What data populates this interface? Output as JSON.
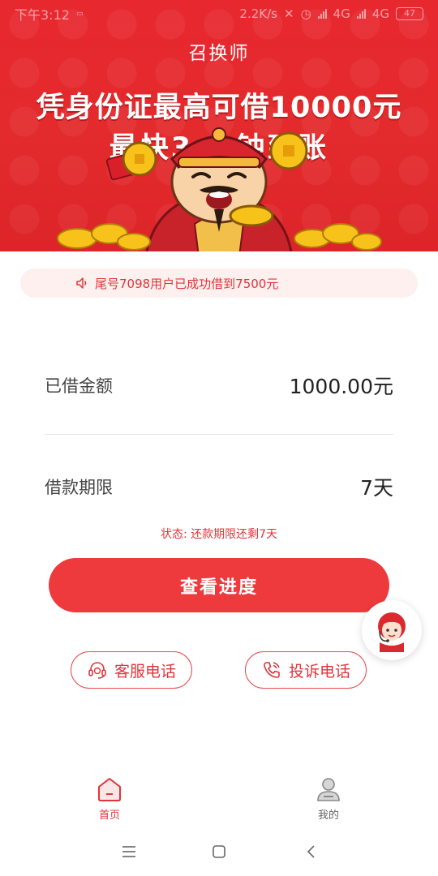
{
  "status_bar": {
    "time": "下午3:12",
    "network_speed": "2.2K/s",
    "net1": "4G",
    "net2": "4G",
    "battery": "47"
  },
  "header": {
    "app_title": "召换师",
    "headline_line1": "凭身份证最高可借10000元",
    "headline_line2": "最快3     分钟到账"
  },
  "notice": {
    "text": "尾号7098用户已成功借到7500元"
  },
  "loan": {
    "amount_label": "已借金额",
    "amount_value": "1000.00元",
    "term_label": "借款期限",
    "term_value": "7天",
    "status_text": "状态: 还款期限还剩7天"
  },
  "actions": {
    "view_progress": "查看进度",
    "service_phone": "客服电话",
    "complaint_phone": "投诉电话"
  },
  "tabs": [
    {
      "label": "首页",
      "active": true
    },
    {
      "label": "我的",
      "active": false
    }
  ],
  "colors": {
    "brand_red": "#ef3a3d",
    "banner_red": "#e32a2c",
    "notice_bg": "#fdf0ee",
    "gold": "#f7c21a"
  },
  "icons": {
    "notice": "speaker-icon",
    "service": "headset-icon",
    "complaint": "phone-icon",
    "home": "home-icon",
    "mine": "user-icon",
    "floating": "customer-service-agent-icon"
  }
}
